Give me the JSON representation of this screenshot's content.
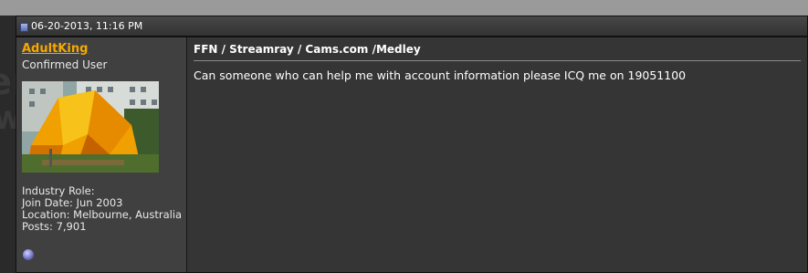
{
  "post": {
    "date": "06-20-2013, 11:16 PM",
    "user": {
      "username": "AdultKing",
      "title": "Confirmed User",
      "industry_role_label": "Industry Role:",
      "join_date": "Join Date: Jun 2003",
      "location": "Location: Melbourne, Australia",
      "posts": "Posts: 7,901",
      "online_status_icon": "online-status-icon"
    },
    "title": "FFN / Streamray / Cams.com /Medley",
    "body": "Can someone who can help me with account information please ICQ me on 19051100"
  },
  "colors": {
    "username": "#f5a800",
    "header_bg": "#3d3d3d",
    "message_bg": "#353535",
    "userinfo_bg": "#404040"
  }
}
